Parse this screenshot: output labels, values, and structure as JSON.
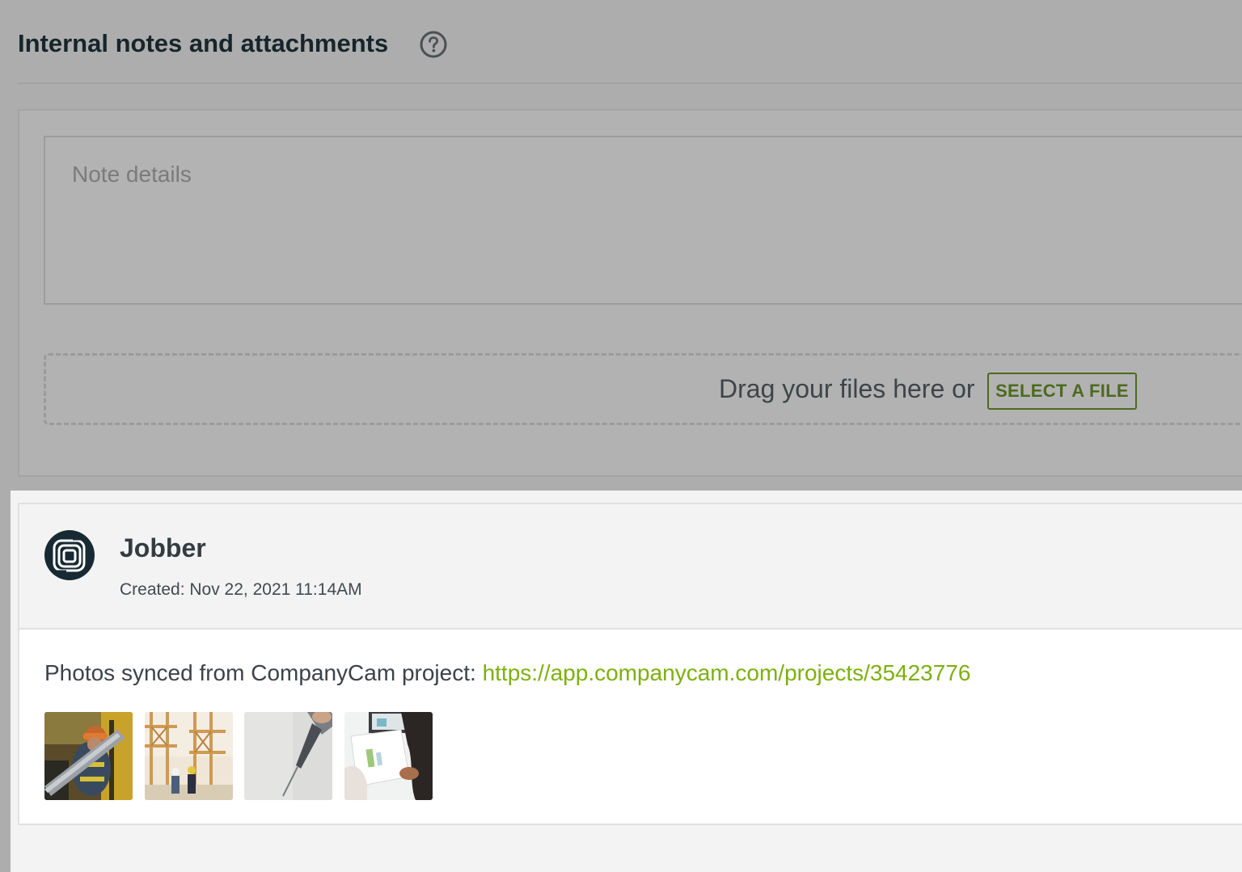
{
  "section": {
    "title": "Internal notes and attachments",
    "help_icon": "question-circle-icon"
  },
  "note_form": {
    "placeholder": "Note details",
    "drop_text": "Drag your files here or",
    "select_file_label": "SELECT A FILE"
  },
  "note": {
    "author": "Jobber",
    "avatar_icon": "jobber-logo-icon",
    "created": "Created: Nov 22, 2021 11:14AM",
    "body_text": "Photos synced from CompanyCam project: ",
    "link_text": "https://app.companycam.com/projects/35423776",
    "thumbnails": [
      {
        "name": "worker-carrying-pipe-photo"
      },
      {
        "name": "scaffolding-site-photo"
      },
      {
        "name": "drill-on-wall-photo"
      },
      {
        "name": "laptop-paperwork-photo"
      }
    ]
  },
  "colors": {
    "overlay": "#adadad",
    "link_green": "#7db00e",
    "button_green": "#4c6a1e",
    "title_text": "#17252b"
  }
}
